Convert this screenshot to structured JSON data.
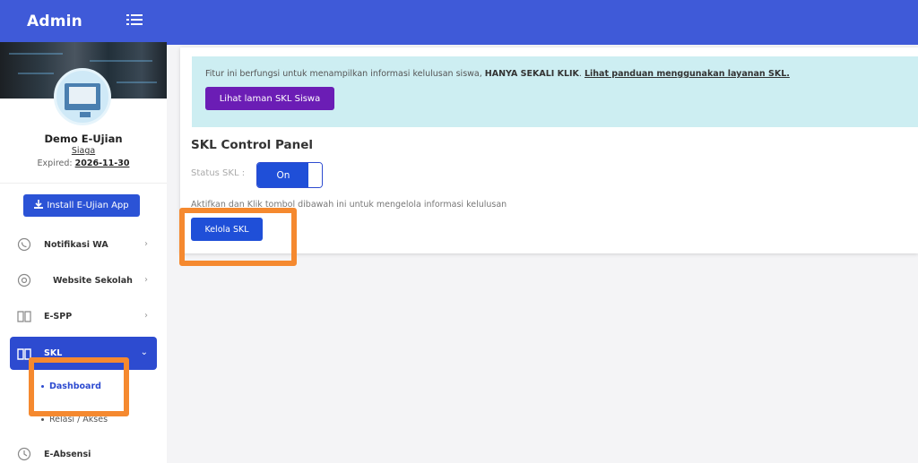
{
  "sidebar": {
    "brand": "Admin",
    "profile": {
      "name": "Demo E-Ujian",
      "level": "Siaga",
      "expired_label": "Expired:",
      "expired_date": "2026-11-30"
    },
    "install_button": "Install E-Ujian App",
    "items": [
      {
        "label": "Notifikasi WA",
        "icon": "whatsapp-icon"
      },
      {
        "label": "Website Sekolah",
        "icon": "chrome-icon"
      },
      {
        "label": "E-SPP",
        "icon": "book-icon"
      },
      {
        "label": "SKL",
        "icon": "book-open-icon"
      },
      {
        "label": "E-Absensi",
        "icon": "clock-icon"
      }
    ],
    "skl_sub": [
      "Dashboard",
      "Relasi / Akses"
    ]
  },
  "main": {
    "info": {
      "text": "Fitur ini berfungsi untuk menampilkan informasi kelulusan siswa, ",
      "emphasis": "HANYA SEKALI KLIK",
      "sep": ". ",
      "link": "Lihat panduan menggunakan layanan SKL.",
      "button": "Lihat laman SKL Siswa"
    },
    "panel_title": "SKL Control Panel",
    "status_label": "Status SKL :",
    "toggle_state": "On",
    "hint": "Aktifkan dan Klik tombol dibawah ini untuk mengelola informasi kelulusan",
    "manage_button": "Kelola SKL"
  },
  "colors": {
    "primary": "#3f5ad8",
    "button": "#1f4fd8",
    "purple": "#6b1db5",
    "info_bg": "#cdeef2",
    "highlight": "#f5892f"
  }
}
